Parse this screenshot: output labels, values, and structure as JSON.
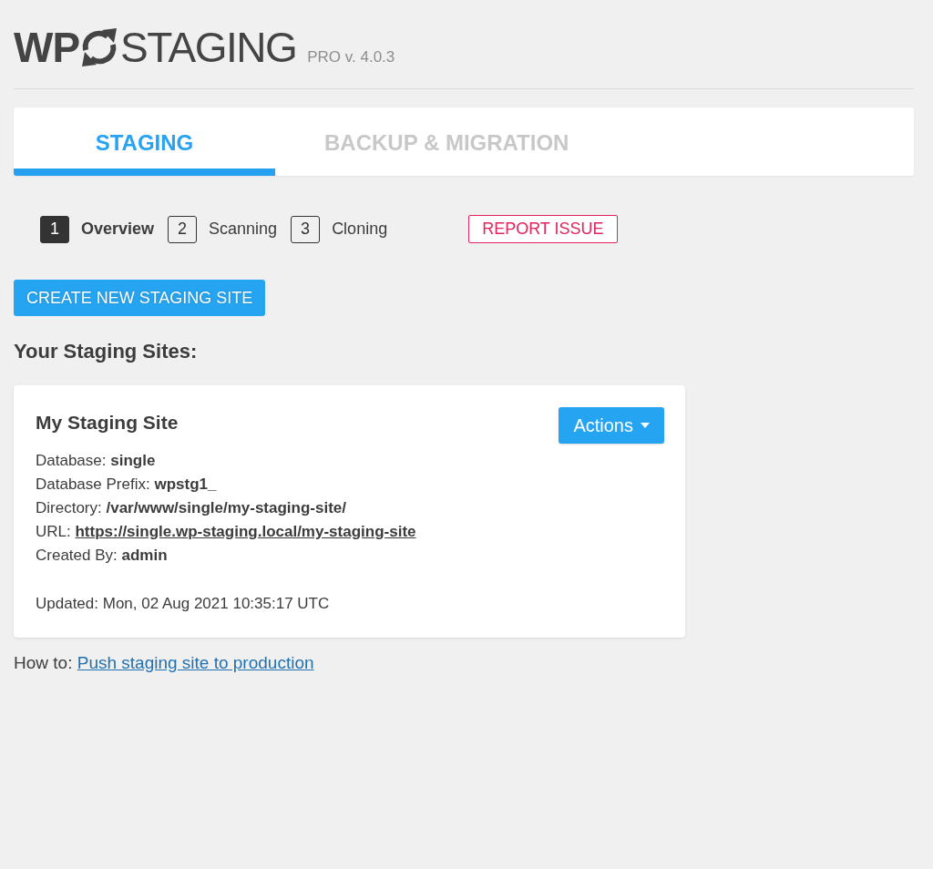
{
  "header": {
    "logo_left": "WP",
    "logo_right": "STAGING",
    "edition": "PRO v. 4.0.3"
  },
  "tabs": [
    {
      "label": "STAGING",
      "selected": true
    },
    {
      "label": "BACKUP & MIGRATION",
      "selected": false
    }
  ],
  "steps": [
    {
      "number": "1",
      "label": "Overview",
      "selected": true
    },
    {
      "number": "2",
      "label": "Scanning",
      "selected": false
    },
    {
      "number": "3",
      "label": "Cloning",
      "selected": false
    }
  ],
  "report_button": "REPORT ISSUE",
  "create_button": "CREATE NEW STAGING SITE",
  "section_title": "Your Staging Sites:",
  "sites": [
    {
      "name": "My Staging Site",
      "actions_button": "Actions",
      "details": [
        {
          "label": "Database:",
          "value": "single",
          "kind": "text"
        },
        {
          "label": "Database Prefix:",
          "value": "wpstg1_",
          "kind": "text"
        },
        {
          "label": "Directory:",
          "value": "/var/www/single/my-staging-site/",
          "kind": "text"
        },
        {
          "label": "URL:",
          "value": "https://single.wp-staging.local/my-staging-site",
          "kind": "link"
        },
        {
          "label": "Created By:",
          "value": "admin",
          "kind": "text"
        }
      ],
      "updated": "Updated: Mon, 02 Aug 2021 10:35:17 UTC"
    }
  ],
  "howto": {
    "label": "How to:",
    "link": "Push staging site to production"
  }
}
